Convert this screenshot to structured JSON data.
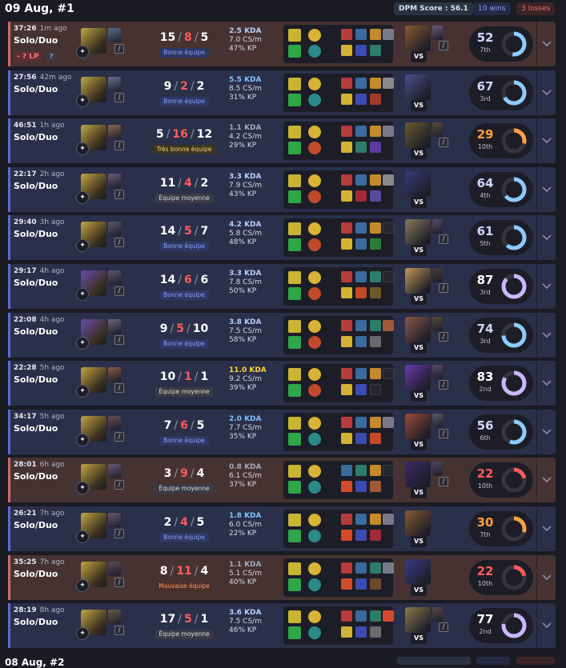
{
  "header": {
    "date_title": "09 Aug, #1",
    "dpm_score": "DPM Score : 56.1",
    "wins": "10 wins",
    "losses": "3 losses"
  },
  "next_header": {
    "date_title": "08 Aug, #2"
  },
  "games": [
    {
      "result": "loss",
      "duration": "37:26",
      "ago": "1m ago",
      "queue": "Solo/Duo",
      "lp": "- ? LP",
      "champion_color": "#c2a542",
      "partner_color": "#5a6e8c",
      "kills": "15",
      "deaths": "8",
      "assists": "5",
      "tag": "Bonne équipe",
      "tag_type": "good",
      "kda_ratio": "2.5 KDA",
      "kda_class": "md",
      "cs": "7.0 CS/m",
      "kp": "47% KP",
      "runes": [
        "#d9b237",
        "#2a8a8a"
      ],
      "vs_color": "#8c5a2e",
      "vs_partner": "#6a5a7a",
      "score": "52",
      "place": "7th",
      "score_color": "#cfd6ff",
      "ring_color": "#8ecbff",
      "ring_pct": 0.52,
      "items": [
        "#b83b3b",
        "#3a6b9c",
        "#c58a2c",
        "#d4b234",
        "#3c4bb0",
        "#2e7c6a",
        "#7a7a8a"
      ]
    },
    {
      "result": "win",
      "duration": "27:56",
      "ago": "42m ago",
      "queue": "Solo/Duo",
      "champion_color": "#c2a542",
      "partner_color": "#6a7290",
      "kills": "9",
      "deaths": "2",
      "assists": "2",
      "tag": "Bonne équipe",
      "tag_type": "good",
      "kda_ratio": "5.5 KDA",
      "kda_class": "hi",
      "cs": "8.5 CS/m",
      "kp": "31% KP",
      "runes": [
        "#d9b237",
        "#2a8a8a"
      ],
      "vs_color": "#4a4f8a",
      "vs_partner": "",
      "score": "67",
      "place": "3rd",
      "score_color": "#cfd6ff",
      "ring_color": "#8ecbff",
      "ring_pct": 0.67,
      "items": [
        "#b83b3b",
        "#3a6b9c",
        "#c58a2c",
        "#d4b234",
        "#3c4bb0",
        "#a03a2a",
        "#8a8a8a"
      ]
    },
    {
      "result": "win",
      "duration": "46:51",
      "ago": "1h ago",
      "queue": "Solo/Duo",
      "champion_color": "#c2a542",
      "partner_color": "#8a6a5a",
      "kills": "5",
      "deaths": "16",
      "assists": "12",
      "tag": "Très bonne équipe",
      "tag_type": "vgood",
      "kda_ratio": "1.1 KDA",
      "kda_class": "lo",
      "cs": "4.2 CS/m",
      "kp": "29% KP",
      "runes": [
        "#d9b237",
        "#c24a2a"
      ],
      "vs_color": "#6a5a2e",
      "vs_partner": "#5a4a3a",
      "score": "29",
      "place": "10th",
      "score_color": "#ff9f43",
      "ring_color": "#ff9f43",
      "ring_pct": 0.29,
      "items": [
        "#b83b3b",
        "#3a6b9c",
        "#c58a2c",
        "#d4b234",
        "#2e7c6a",
        "#5a3aa0",
        "#7a7a8a"
      ]
    },
    {
      "result": "win",
      "duration": "22:17",
      "ago": "2h ago",
      "queue": "Solo/Duo",
      "champion_color": "#c2a542",
      "partner_color": "#6a5a7a",
      "kills": "11",
      "deaths": "4",
      "assists": "2",
      "tag": "Équipe moyenne",
      "tag_type": "avg",
      "kda_ratio": "3.3 KDA",
      "kda_class": "md",
      "cs": "7.9 CS/m",
      "kp": "43% KP",
      "runes": [
        "#d9b237",
        "#c24a2a"
      ],
      "vs_color": "#3a3a7a",
      "vs_partner": "",
      "score": "64",
      "place": "4th",
      "score_color": "#cfd6ff",
      "ring_color": "#8ecbff",
      "ring_pct": 0.64,
      "items": [
        "#b83b3b",
        "#3a6b9c",
        "#c58a2c",
        "#d4b234",
        "#a02a3a",
        "#5a4a9a",
        "#8a8a8a"
      ]
    },
    {
      "result": "win",
      "duration": "29:40",
      "ago": "3h ago",
      "queue": "Solo/Duo",
      "champion_color": "#c2a542",
      "partner_color": "#5a5a6a",
      "kills": "14",
      "deaths": "5",
      "assists": "7",
      "tag": "Bonne équipe",
      "tag_type": "good",
      "kda_ratio": "4.2 KDA",
      "kda_class": "md",
      "cs": "5.8 CS/m",
      "kp": "48% KP",
      "runes": [
        "#d9b237",
        "#c24a2a"
      ],
      "vs_color": "#8a7a5a",
      "vs_partner": "#5a4a6a",
      "score": "61",
      "place": "5th",
      "score_color": "#cfd6ff",
      "ring_color": "#8ecbff",
      "ring_pct": 0.61,
      "items": [
        "#b83b3b",
        "#3a6b9c",
        "#c58a2c",
        "#d4b234",
        "#3a6b9c",
        "#2e7c3a",
        "#222"
      ]
    },
    {
      "result": "win",
      "duration": "29:17",
      "ago": "4h ago",
      "queue": "Solo/Duo",
      "champion_color": "#6a4ab0",
      "partner_color": "#5a5a6a",
      "kills": "14",
      "deaths": "6",
      "assists": "6",
      "tag": "Bonne équipe",
      "tag_type": "good",
      "kda_ratio": "3.3 KDA",
      "kda_class": "md",
      "cs": "7.8 CS/m",
      "kp": "50% KP",
      "runes": [
        "#d9b237",
        "#c24a2a"
      ],
      "vs_color": "#c29a5a",
      "vs_partner": "#4a3a3a",
      "score": "87",
      "place": "3rd",
      "score_color": "#ffffff",
      "ring_color": "#cbb6ff",
      "ring_pct": 0.87,
      "items": [
        "#b83b3b",
        "#3a6b9c",
        "#2e7c6a",
        "#d4b234",
        "#c24a2a",
        "#6a5a2a",
        "#222"
      ]
    },
    {
      "result": "win",
      "duration": "22:08",
      "ago": "4h ago",
      "queue": "Solo/Duo",
      "champion_color": "#6a4ab0",
      "partner_color": "#6a6a7a",
      "kills": "9",
      "deaths": "5",
      "assists": "10",
      "tag": "Bonne équipe",
      "tag_type": "good",
      "kda_ratio": "3.8 KDA",
      "kda_class": "md",
      "cs": "7.5 CS/m",
      "kp": "58% KP",
      "runes": [
        "#d9b237",
        "#c24a2a"
      ],
      "vs_color": "#8a5a4a",
      "vs_partner": "#5a4a3a",
      "score": "74",
      "place": "3rd",
      "score_color": "#cfd6ff",
      "ring_color": "#8ecbff",
      "ring_pct": 0.74,
      "items": [
        "#b83b3b",
        "#3a6b9c",
        "#2e7c6a",
        "#d4b234",
        "#3a6b9c",
        "#6a6a6a",
        "#a05a3a"
      ]
    },
    {
      "result": "win",
      "duration": "22:28",
      "ago": "5h ago",
      "queue": "Solo/Duo",
      "champion_color": "#c2a542",
      "partner_color": "#8a5a4a",
      "kills": "10",
      "deaths": "1",
      "assists": "1",
      "tag": "Équipe moyenne",
      "tag_type": "avg",
      "kda_ratio": "11.0 KDA",
      "kda_class": "top",
      "cs": "9.2 CS/m",
      "kp": "39% KP",
      "runes": [
        "#d9b237",
        "#c24a2a"
      ],
      "vs_color": "#6a3ab0",
      "vs_partner": "#5a4a6a",
      "score": "83",
      "place": "2nd",
      "score_color": "#ffffff",
      "ring_color": "#cbb6ff",
      "ring_pct": 0.83,
      "items": [
        "#b83b3b",
        "#3a6b9c",
        "#c58a2c",
        "#d4b234",
        "#3c4bb0",
        "#222",
        "#222"
      ]
    },
    {
      "result": "win",
      "duration": "34:17",
      "ago": "5h ago",
      "queue": "Solo/Duo",
      "champion_color": "#c2a542",
      "partner_color": "#6a4a5a",
      "kills": "7",
      "deaths": "6",
      "assists": "5",
      "tag": "Bonne équipe",
      "tag_type": "good",
      "kda_ratio": "2.0 KDA",
      "kda_class": "hi",
      "cs": "7.7 CS/m",
      "kp": "35% KP",
      "runes": [
        "#d9b237",
        "#2a8a8a"
      ],
      "vs_color": "#a04a3a",
      "vs_partner": "#5a5a6a",
      "score": "56",
      "place": "6th",
      "score_color": "#cfd6ff",
      "ring_color": "#8ecbff",
      "ring_pct": 0.56,
      "items": [
        "#b83b3b",
        "#3a6b9c",
        "#c58a2c",
        "#d4b234",
        "#3c4bb0",
        "#c24a2a",
        "#7a7a8a"
      ]
    },
    {
      "result": "loss",
      "duration": "28:01",
      "ago": "6h ago",
      "queue": "Solo/Duo",
      "champion_color": "#c2a542",
      "partner_color": "#6a5a7a",
      "kills": "3",
      "deaths": "9",
      "assists": "4",
      "tag": "Équipe moyenne",
      "tag_type": "avg",
      "kda_ratio": "0.8 KDA",
      "kda_class": "lo",
      "cs": "6.1 CS/m",
      "kp": "37% KP",
      "runes": [
        "#d9b237",
        "#2a8a8a"
      ],
      "vs_color": "#3a2a6a",
      "vs_partner": "#4a4a6a",
      "score": "22",
      "place": "10th",
      "score_color": "#ff5b5b",
      "ring_color": "#ff5b5b",
      "ring_pct": 0.22,
      "items": [
        "#3a6b9c",
        "#2e7c6a",
        "#c58a2c",
        "#d44a2a",
        "#3c4bb0",
        "#a05a3a",
        "#222"
      ]
    },
    {
      "result": "win",
      "duration": "26:21",
      "ago": "7h ago",
      "queue": "Solo/Duo",
      "champion_color": "#c2a542",
      "partner_color": "#6a5a6a",
      "kills": "2",
      "deaths": "4",
      "assists": "5",
      "tag": "Bonne équipe",
      "tag_type": "good",
      "kda_ratio": "1.8 KDA",
      "kda_class": "hi",
      "cs": "6.0 CS/m",
      "kp": "22% KP",
      "runes": [
        "#d9b237",
        "#2a8a8a"
      ],
      "vs_color": "#8c5a2e",
      "vs_partner": "",
      "score": "30",
      "place": "7th",
      "score_color": "#ff9f43",
      "ring_color": "#ff9f43",
      "ring_pct": 0.3,
      "items": [
        "#b83b3b",
        "#3a6b9c",
        "#c58a2c",
        "#d44a2a",
        "#3c4bb0",
        "#a02a3a",
        "#7a7a8a"
      ]
    },
    {
      "result": "loss",
      "duration": "35:25",
      "ago": "7h ago",
      "queue": "Solo/Duo",
      "champion_color": "#c2a542",
      "partner_color": "#5a4a5a",
      "kills": "8",
      "deaths": "11",
      "assists": "4",
      "tag": "Mauvaise équipe",
      "tag_type": "bad",
      "kda_ratio": "1.1 KDA",
      "kda_class": "lo",
      "cs": "5.1 CS/m",
      "kp": "40% KP",
      "runes": [
        "#d9b237",
        "#2a8a8a"
      ],
      "vs_color": "#3a3a8a",
      "vs_partner": "",
      "score": "22",
      "place": "10th",
      "score_color": "#ff5b5b",
      "ring_color": "#ff5b5b",
      "ring_pct": 0.22,
      "items": [
        "#b83b3b",
        "#3a6b9c",
        "#2e7c6a",
        "#d44a2a",
        "#3c4bb0",
        "#6a4a2a",
        "#7a7a8a"
      ]
    },
    {
      "result": "win",
      "duration": "28:19",
      "ago": "8h ago",
      "queue": "Solo/Duo",
      "champion_color": "#c2a542",
      "partner_color": "#6a5a4a",
      "kills": "17",
      "deaths": "5",
      "assists": "1",
      "tag": "Équipe moyenne",
      "tag_type": "avg",
      "kda_ratio": "3.6 KDA",
      "kda_class": "md",
      "cs": "7.5 CS/m",
      "kp": "46% KP",
      "runes": [
        "#d9b237",
        "#2a8a8a"
      ],
      "vs_color": "#8a7a4a",
      "vs_partner": "#5a4a4a",
      "score": "77",
      "place": "2nd",
      "score_color": "#ffffff",
      "ring_color": "#cbb6ff",
      "ring_pct": 0.77,
      "items": [
        "#b83b3b",
        "#3a6b9c",
        "#2e7c6a",
        "#d4b234",
        "#3c4bb0",
        "#6a6a6a",
        "#d44a2a"
      ]
    }
  ]
}
